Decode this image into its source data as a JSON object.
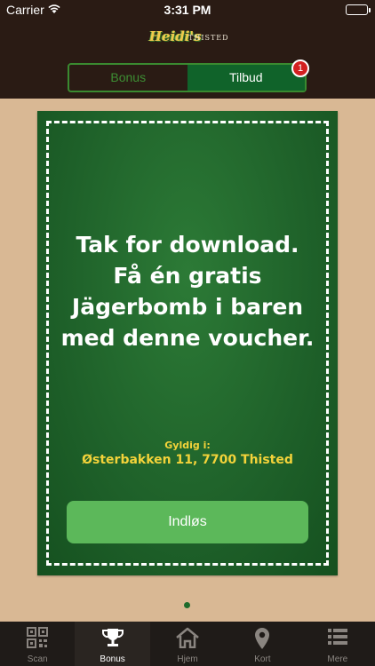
{
  "status_bar": {
    "carrier": "Carrier",
    "time": "3:31 PM"
  },
  "logo": {
    "script_text": "Heidi's",
    "city": "THISTED"
  },
  "segmented": {
    "tabs": [
      {
        "label": "Bonus",
        "selected": false
      },
      {
        "label": "Tilbud",
        "selected": true,
        "badge": "1"
      }
    ]
  },
  "voucher": {
    "headline": "Tak for download.\nFå én gratis\nJägerbomb i baren\nmed denne voucher.",
    "valid_label": "Gyldig i:",
    "valid_address": "Østerbakken 11, 7700 Thisted",
    "redeem_label": "Indløs"
  },
  "tabbar": {
    "items": [
      {
        "label": "Scan",
        "icon": "qr-code-icon",
        "active": false
      },
      {
        "label": "Bonus",
        "icon": "trophy-icon",
        "active": true
      },
      {
        "label": "Hjem",
        "icon": "home-icon",
        "active": false
      },
      {
        "label": "Kort",
        "icon": "map-pin-icon",
        "active": false
      },
      {
        "label": "Mere",
        "icon": "list-icon",
        "active": false
      }
    ]
  },
  "colors": {
    "header_bg": "#2a1b14",
    "page_bg": "#d9b894",
    "card_green": "#1e6029",
    "accent_green": "#5cb85a",
    "voucher_text_yellow": "#f3d33a",
    "badge_red": "#d32020"
  }
}
